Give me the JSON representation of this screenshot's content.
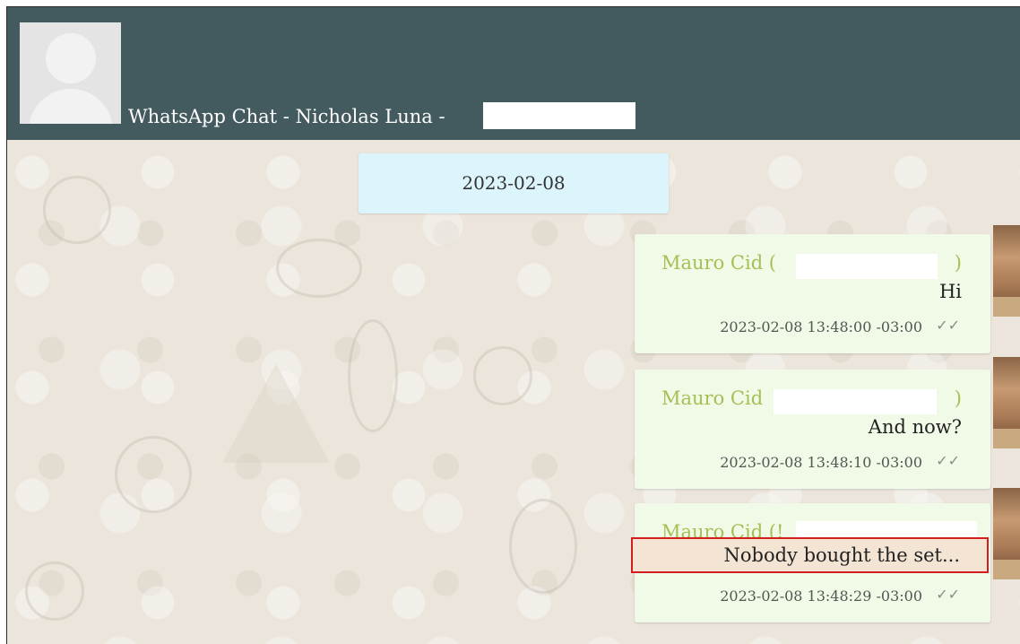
{
  "header": {
    "title": "WhatsApp Chat - Nicholas Luna -"
  },
  "date_separator": "2023-02-08",
  "messages": [
    {
      "sender": "Mauro Cid (",
      "sender_close": ")",
      "text": "Hi",
      "timestamp": "2023-02-08 13:48:00 -03:00",
      "ticks": "✓✓"
    },
    {
      "sender": "Mauro Cid",
      "sender_close": ")",
      "text": "And now?",
      "timestamp": "2023-02-08 13:48:10 -03:00",
      "ticks": "✓✓"
    },
    {
      "sender": "Mauro Cid (!",
      "sender_close": "",
      "text": "Nobody bought the set...",
      "timestamp": "2023-02-08 13:48:29 -03:00",
      "ticks": "✓✓"
    }
  ],
  "colors": {
    "header_bg": "#435a5e",
    "bubble_bg": "#f0fae6",
    "sender_color": "#a6bf55",
    "date_chip_bg": "#dcf4fb",
    "highlight_border": "#d41e1e"
  }
}
